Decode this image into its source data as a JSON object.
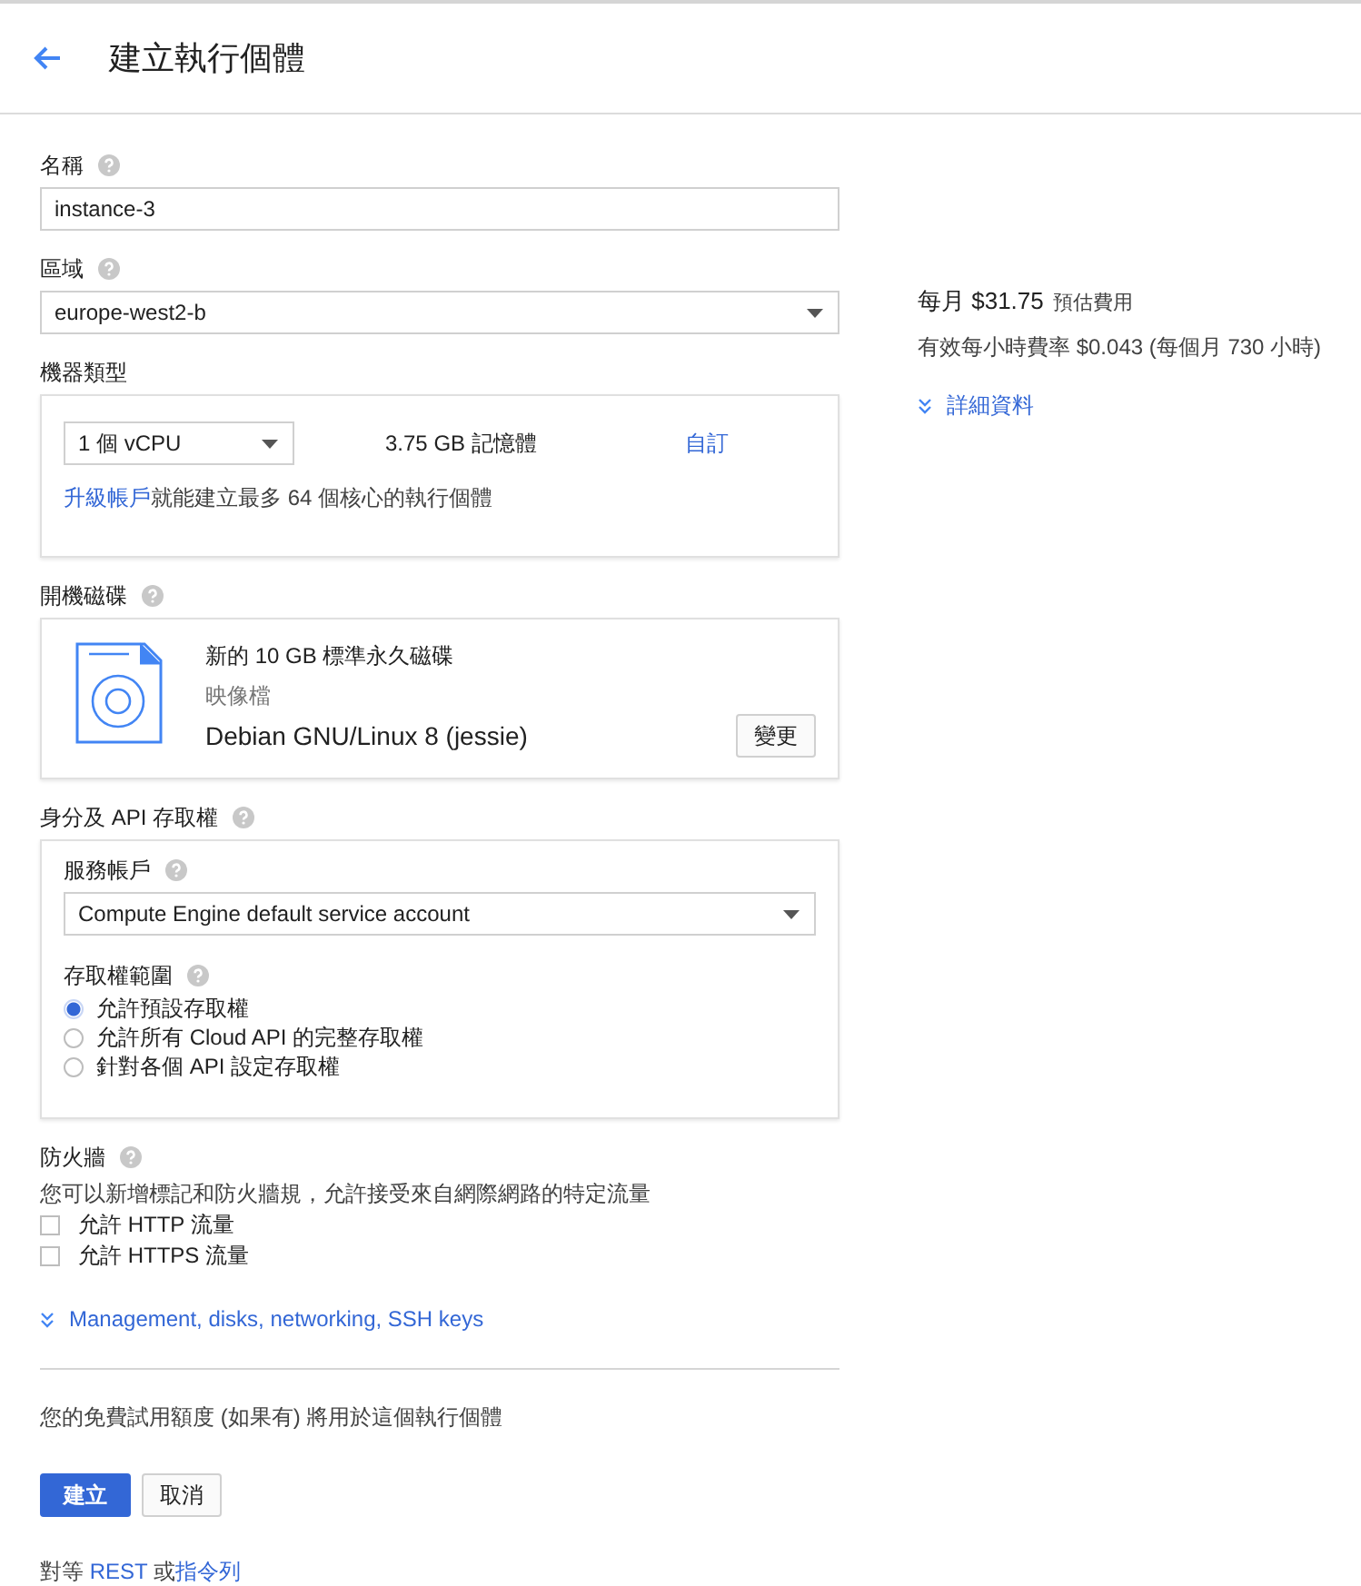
{
  "header": {
    "title": "建立執行個體"
  },
  "name_field": {
    "label": "名稱",
    "value": "instance-3"
  },
  "zone": {
    "label": "區域",
    "value": "europe-west2-b"
  },
  "machine_type": {
    "label": "機器類型",
    "cpu": "1 個 vCPU",
    "memory": "3.75 GB 記憶體",
    "customize": "自訂",
    "upgrade_link": "升級帳戶",
    "upgrade_text": "就能建立最多 64 個核心的執行個體"
  },
  "boot_disk": {
    "label": "開機磁碟",
    "title": "新的 10 GB 標準永久磁碟",
    "image_label": "映像檔",
    "image": "Debian GNU/Linux 8 (jessie)",
    "change": "變更"
  },
  "identity": {
    "label": "身分及 API 存取權",
    "account_label": "服務帳戶",
    "account": "Compute Engine default service account",
    "scopes_label": "存取權範圍",
    "scopes": [
      {
        "label": "允許預設存取權",
        "selected": true
      },
      {
        "label": "允許所有 Cloud API 的完整存取權",
        "selected": false
      },
      {
        "label": "針對各個 API 設定存取權",
        "selected": false
      }
    ]
  },
  "firewall": {
    "label": "防火牆",
    "description": "您可以新增標記和防火牆規，允許接受來自網際網路的特定流量",
    "options": [
      {
        "label": "允許 HTTP 流量",
        "checked": false
      },
      {
        "label": "允許 HTTPS 流量",
        "checked": false
      }
    ]
  },
  "more_link": "Management, disks, networking, SSH keys",
  "trial_note": "您的免費試用額度 (如果有) 將用於這個執行個體",
  "buttons": {
    "create": "建立",
    "cancel": "取消"
  },
  "equivalent": {
    "prefix": "對等",
    "rest": "REST",
    "middle": "或",
    "cli": "指令列"
  },
  "pricing": {
    "amount": "每月 $31.75",
    "amount_label": "預估費用",
    "rate": "有效每小時費率 $0.043 (每個月 730 小時)",
    "details": "詳細資料"
  }
}
